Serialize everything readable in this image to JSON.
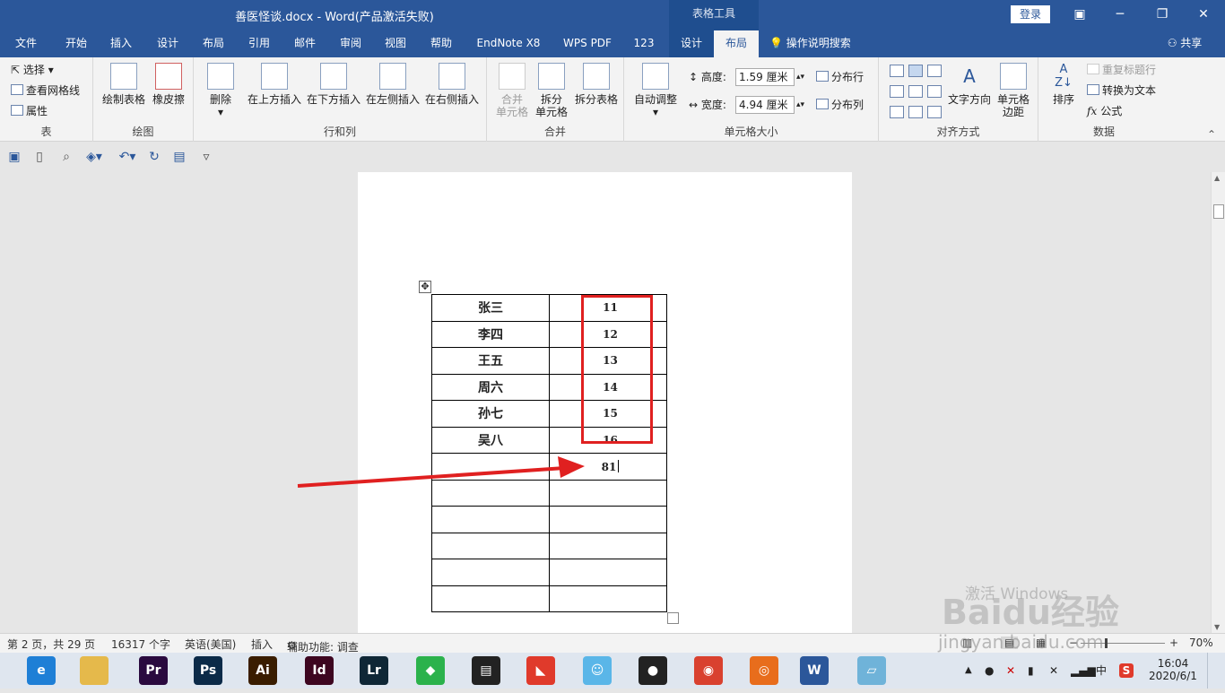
{
  "window": {
    "title": "善医怪谈.docx  -  Word(产品激活失败)",
    "context_tab_group": "表格工具",
    "login": "登录",
    "minimize": "─",
    "restore": "❐",
    "close": "✕",
    "ribbon_display": "▣"
  },
  "tabs": [
    "文件",
    "开始",
    "插入",
    "设计",
    "布局",
    "引用",
    "邮件",
    "审阅",
    "视图",
    "帮助",
    "EndNote X8",
    "WPS PDF",
    "123",
    "设计",
    "布局"
  ],
  "active_tab": "布局",
  "tell_me": "操作说明搜索",
  "share": "共享",
  "ribbon": {
    "table": {
      "label": "表",
      "select": "选择",
      "gridlines": "查看网格线",
      "properties": "属性"
    },
    "draw": {
      "label": "绘图",
      "draw_table": "绘制表格",
      "eraser": "橡皮擦"
    },
    "rows_cols": {
      "label": "行和列",
      "delete": "删除",
      "insert_above": "在上方插入",
      "insert_below": "在下方插入",
      "insert_left": "在左侧插入",
      "insert_right": "在右侧插入"
    },
    "merge": {
      "label": "合并",
      "merge_cells_1": "合并",
      "merge_cells_2": "单元格",
      "split_cells_1": "拆分",
      "split_cells_2": "单元格",
      "split_table": "拆分表格"
    },
    "cell_size": {
      "label": "单元格大小",
      "autofit": "自动调整",
      "height_label": "高度:",
      "height_value": "1.59 厘米",
      "width_label": "宽度:",
      "width_value": "4.94 厘米",
      "distribute_rows": "分布行",
      "distribute_cols": "分布列"
    },
    "alignment": {
      "label": "对齐方式",
      "text_direction": "文字方向",
      "cell_margins_1": "单元格",
      "cell_margins_2": "边距"
    },
    "data": {
      "label": "数据",
      "sort": "排序",
      "repeat_header": "重复标题行",
      "convert_to_text": "转换为文本",
      "formula": "公式",
      "fx": "fx"
    }
  },
  "table_rows": [
    [
      "张三",
      "11"
    ],
    [
      "李四",
      "12"
    ],
    [
      "王五",
      "13"
    ],
    [
      "周六",
      "14"
    ],
    [
      "孙七",
      "15"
    ],
    [
      "吴八",
      "16"
    ],
    [
      "",
      "81"
    ],
    [
      "",
      ""
    ],
    [
      "",
      ""
    ],
    [
      "",
      ""
    ],
    [
      "",
      ""
    ],
    [
      "",
      ""
    ]
  ],
  "status": {
    "page": "第 2 页，共 29 页",
    "words": "16317 个字",
    "language": "英语(美国)",
    "mode": "插入",
    "accessibility": "辅助功能: 调查",
    "zoom": "70%",
    "zoom_minus": "−",
    "zoom_plus": "+"
  },
  "taskbar": {
    "apps": [
      {
        "name": "browser-icon",
        "text": "e",
        "color": "#1e7fd6"
      },
      {
        "name": "file-explorer-icon",
        "text": "",
        "color": "#e5b94b"
      },
      {
        "name": "premiere-icon",
        "text": "Pr",
        "color": "#2a0a3f"
      },
      {
        "name": "photoshop-icon",
        "text": "Ps",
        "color": "#0b2a48"
      },
      {
        "name": "illustrator-icon",
        "text": "Ai",
        "color": "#3a1d00"
      },
      {
        "name": "indesign-icon",
        "text": "Id",
        "color": "#3d0620"
      },
      {
        "name": "lightroom-icon",
        "text": "Lr",
        "color": "#0f2736"
      },
      {
        "name": "green-app-icon",
        "text": "◆",
        "color": "#2bb24c"
      },
      {
        "name": "video-editor-icon",
        "text": "▤",
        "color": "#222222"
      },
      {
        "name": "colorful-app-icon",
        "text": "◣",
        "color": "#e03a2b"
      },
      {
        "name": "cat-app-icon",
        "text": "☺",
        "color": "#5ab6e8"
      },
      {
        "name": "qq-icon",
        "text": "●",
        "color": "#222222"
      },
      {
        "name": "chrome-icon",
        "text": "◉",
        "color": "#d9412f"
      },
      {
        "name": "orange-app-icon",
        "text": "◎",
        "color": "#e86d1c"
      },
      {
        "name": "word-icon",
        "text": "W",
        "color": "#2b579a"
      },
      {
        "name": "notepad-icon",
        "text": "▱",
        "color": "#6fb3d9"
      }
    ],
    "ime": "中",
    "sogou": "S",
    "time": "16:04",
    "date": "2020/6/1"
  },
  "watermark": {
    "brand": "Baidu经验",
    "url": "jingyan.baidu.com",
    "activate": "激活 Windows"
  },
  "colors": {
    "word_blue": "#2b579a",
    "highlight_red": "#e02020"
  }
}
